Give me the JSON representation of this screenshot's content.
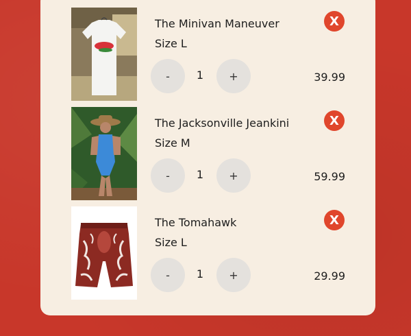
{
  "cart": {
    "items": [
      {
        "name": "The Minivan Maneuver",
        "size": "Size L",
        "quantity": "1",
        "price": "39.99",
        "minus_label": "-",
        "plus_label": "+",
        "remove_label": "X",
        "image": "white-graphic-tshirt-photo"
      },
      {
        "name": "The Jacksonville Jeankini",
        "size": "Size M",
        "quantity": "1",
        "price": "59.99",
        "minus_label": "-",
        "plus_label": "+",
        "remove_label": "X",
        "image": "denim-swimsuit-model-photo"
      },
      {
        "name": "The Tomahawk",
        "size": "Size L",
        "quantity": "1",
        "price": "29.99",
        "minus_label": "-",
        "plus_label": "+",
        "remove_label": "X",
        "image": "steak-print-boxer-brief-photo"
      }
    ]
  },
  "colors": {
    "background": "#c8372a",
    "panel": "#f7eee2",
    "remove_button": "#e0462c",
    "qty_button": "#e4e1dd"
  }
}
